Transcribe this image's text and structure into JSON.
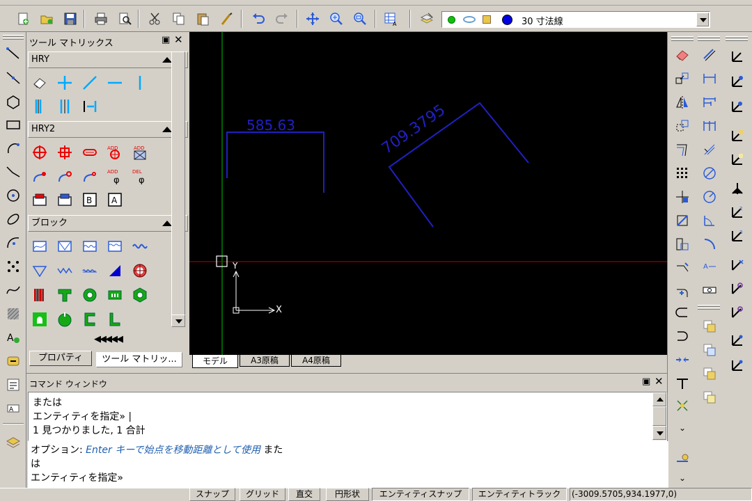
{
  "toolbar": {
    "layer_name": "30 寸法線"
  },
  "tool_matrix": {
    "title": "ツール マトリックス",
    "sections": [
      "HRY",
      "HRY2",
      "ブロック"
    ],
    "scroll_label": "◀◀◀◀◀",
    "tabs": [
      "プロパティ",
      "ツール マトリッ..."
    ]
  },
  "drawing": {
    "dim1": "585.63",
    "dim2": "709.3795",
    "axis_y": "Y",
    "axis_x": "X",
    "tabs": [
      "モデル",
      "A3原稿",
      "A4原稿"
    ]
  },
  "command": {
    "title": "コマンド ウィンドウ",
    "history": [
      "または",
      "エンティティを指定» |",
      "1 見つかりました, 1 合計"
    ],
    "prompt_label": "オプション:",
    "prompt_hint": "Enter キーで始点を移動距離として使用",
    "prompt_tail": "また",
    "prompt_line2": "は",
    "prompt_line3": "エンティティを指定»"
  },
  "status": {
    "buttons": [
      "スナップ",
      "グリッド",
      "直交",
      "円形状",
      "エンティティスナップ",
      "エンティティトラック"
    ],
    "coords": "(-3009.5705,934.1977,0)"
  },
  "colors": {
    "canvas": "#000000",
    "dimension": "#2020c0",
    "axis_green": "#00c000",
    "axis_red": "#c00000",
    "hint_blue": "#1f5fb0"
  }
}
